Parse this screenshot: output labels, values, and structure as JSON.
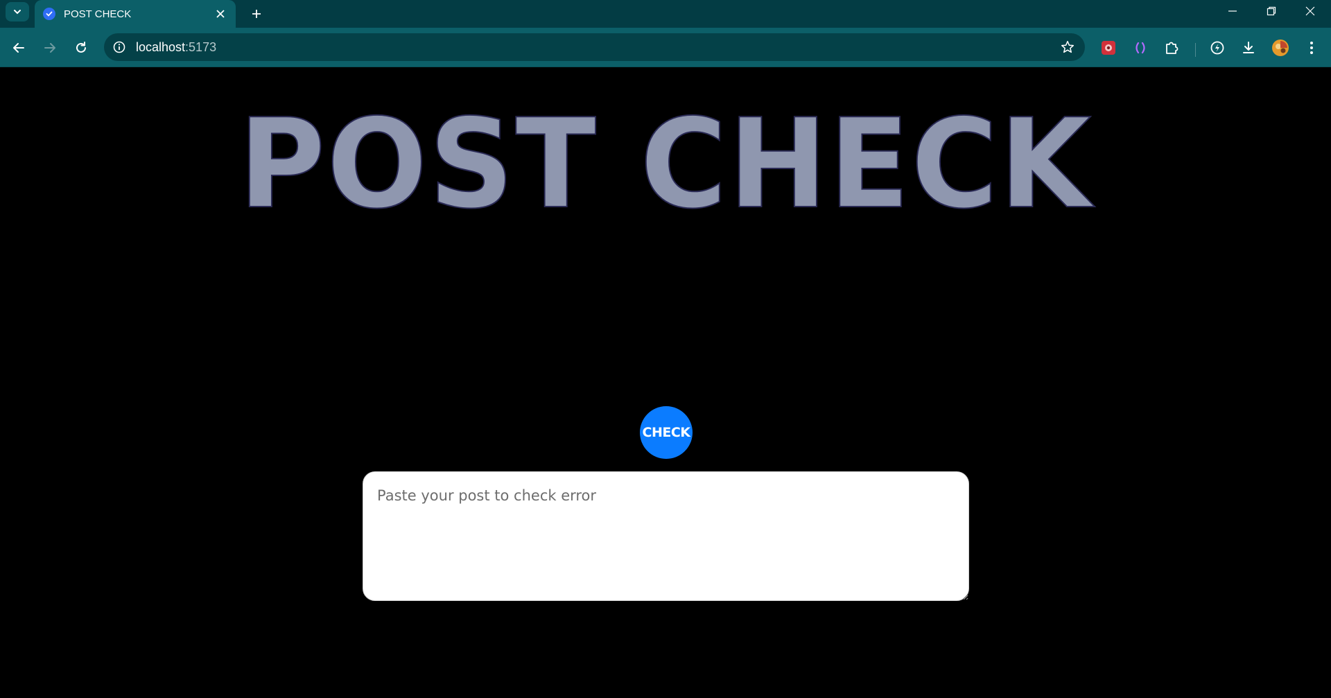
{
  "browser": {
    "tab": {
      "title": "POST CHECK"
    },
    "address_bar": {
      "host": "localhost",
      "port": ":5173"
    },
    "icons": {
      "tab_search": "chevron-down-icon",
      "favicon": "check-badge-icon",
      "tab_close": "close-icon",
      "new_tab": "plus-icon",
      "back": "arrow-left-icon",
      "forward": "arrow-right-icon",
      "reload": "reload-icon",
      "site_info": "info-icon",
      "bookmark": "star-icon",
      "extensions": [
        "red-extension-icon",
        "purple-bracket-extension-icon",
        "puzzle-icon",
        "performance-icon"
      ],
      "downloads": "download-icon",
      "profile": "avatar",
      "menu": "kebab-menu-icon"
    },
    "colors": {
      "tabbar": "#033c44",
      "toolbar": "#0c5f68"
    }
  },
  "page": {
    "title": "POST CHECK",
    "check_button_label": "CHECK",
    "input_placeholder": "Paste your post to check error",
    "colors": {
      "background": "#000000",
      "title": "#8f97af",
      "button": "#0b7cff"
    }
  }
}
